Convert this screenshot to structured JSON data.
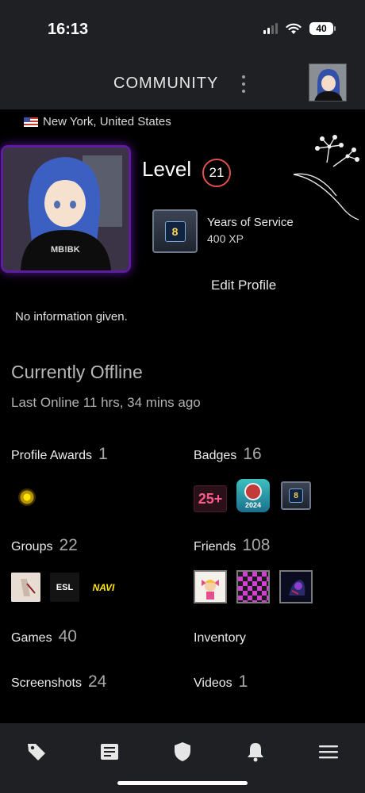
{
  "status_bar": {
    "time": "16:13",
    "battery": "40"
  },
  "header": {
    "title": "COMMUNITY"
  },
  "profile": {
    "location": "New York, United States",
    "level_label": "Level",
    "level": "21",
    "badge_title": "Years of Service",
    "badge_xp": "400 XP",
    "badge_digit": "8",
    "edit_label": "Edit Profile",
    "summary": "No information given.",
    "status": "Currently Offline",
    "last_online": "Last Online 11 hrs, 34 mins ago"
  },
  "stats": {
    "profile_awards": {
      "label": "Profile Awards",
      "count": "1"
    },
    "badges": {
      "label": "Badges",
      "count": "16",
      "items": [
        "25+",
        "2024",
        "8"
      ]
    },
    "groups": {
      "label": "Groups",
      "count": "22",
      "items": [
        "",
        "ESL",
        "NAVI"
      ]
    },
    "friends": {
      "label": "Friends",
      "count": "108"
    },
    "games": {
      "label": "Games",
      "count": "40"
    },
    "inventory": {
      "label": "Inventory"
    },
    "screenshots": {
      "label": "Screenshots",
      "count": "24"
    },
    "videos": {
      "label": "Videos",
      "count": "1"
    }
  },
  "bottom_nav": {
    "items": [
      "tag-icon",
      "news-icon",
      "shield-icon",
      "bell-icon",
      "menu-icon"
    ]
  }
}
